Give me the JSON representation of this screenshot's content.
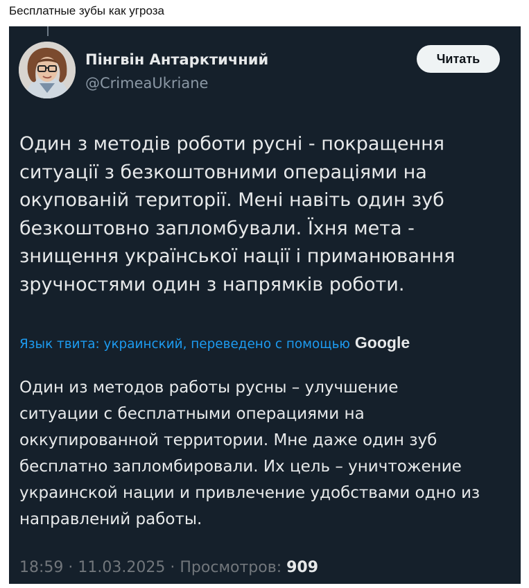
{
  "caption": "Бесплатные зубы как угроза",
  "tweet": {
    "author": {
      "name": "Пінгвін Антарктичний",
      "handle": "@CrimeaUkriane"
    },
    "follow_label": "Читать",
    "text_lines": [
      "Один з методів роботи русні - покращення",
      "ситуації з безкоштовними операціями на",
      "окупованій території. Мені навіть один зуб",
      "безкоштовно запломбували. Їхня мета -",
      "знищення української нації і приманювання",
      "зручностями один з напрямків роботи."
    ],
    "translation_label": "Язык твита: украинский, переведено с помощью",
    "translation_provider": "Google",
    "translated_lines": [
      "Один из методов работы русны – улучшение",
      "ситуации с бесплатными операциями на",
      "оккупированной территории. Мне даже один зуб",
      "бесплатно запломбировали. Их цель – уничтожение",
      "украинской нации и привлечение удобствами одно из",
      "направлений работы."
    ],
    "time": "18:59",
    "date": "11.03.2025",
    "separator": "·",
    "views_label": "Просмотров:",
    "views_count": "909"
  },
  "colors": {
    "tweet_background": "#15202b",
    "text_primary": "#e7e9ea",
    "text_secondary": "#8b98a5",
    "link": "#1d9bf0",
    "button_background": "#eff3f4"
  },
  "icons": {
    "avatar": "user-avatar-photo"
  }
}
